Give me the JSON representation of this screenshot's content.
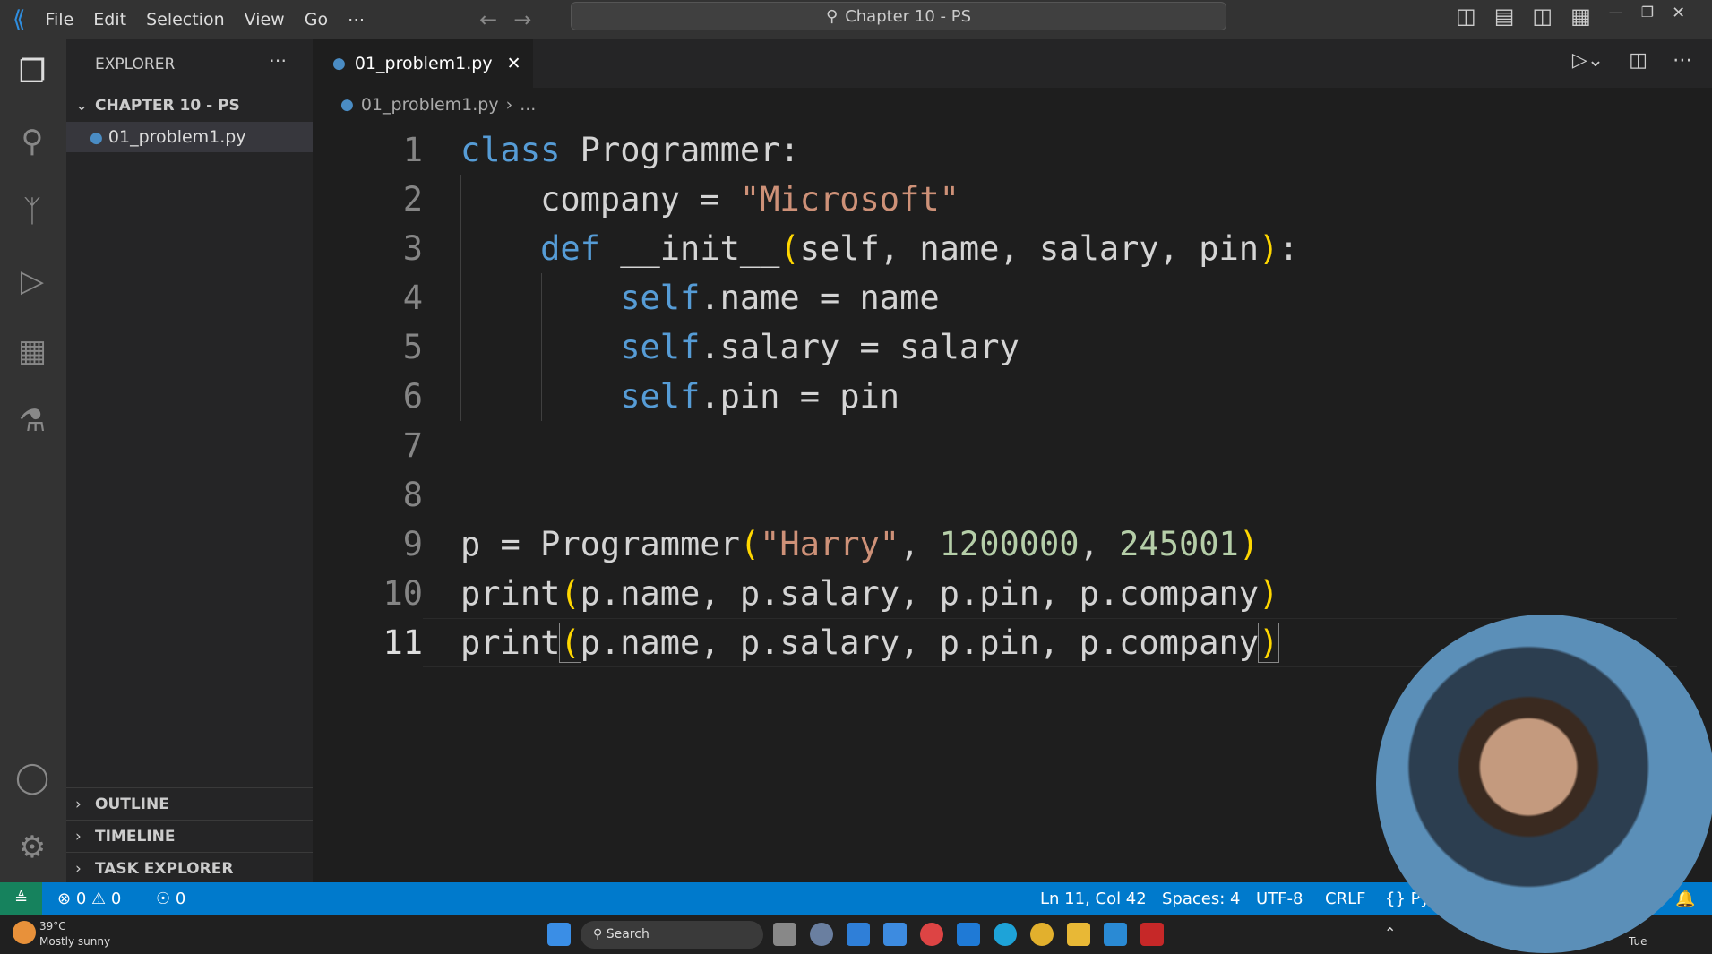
{
  "titlebar": {
    "menus": [
      "File",
      "Edit",
      "Selection",
      "View",
      "Go",
      "⋯"
    ],
    "search": "Chapter 10 - PS"
  },
  "sidebar": {
    "title": "EXPLORER",
    "folder": "CHAPTER 10 - PS",
    "file": "01_problem1.py",
    "sections": [
      "OUTLINE",
      "TIMELINE",
      "TASK EXPLORER"
    ]
  },
  "editor": {
    "tab": "01_problem1.py",
    "breadcrumb": "01_problem1.py",
    "breadcrumb_more": "...",
    "line_numbers": [
      "1",
      "2",
      "3",
      "4",
      "5",
      "6",
      "7",
      "8",
      "9",
      "10",
      "11"
    ]
  },
  "status": {
    "errors": "0",
    "warnings": "0",
    "ports": "0",
    "position": "Ln 11, Col 42",
    "spaces": "Spaces: 4",
    "encoding": "UTF-8",
    "eol": "CRLF",
    "lang": "Py"
  },
  "taskbar": {
    "temp": "39°C",
    "weather": "Mostly sunny",
    "search": "Search",
    "day": "Tue"
  },
  "colors": {
    "status": "#007acc",
    "keyword": "#569cd6",
    "string": "#ce9178",
    "number": "#b5cea8"
  }
}
